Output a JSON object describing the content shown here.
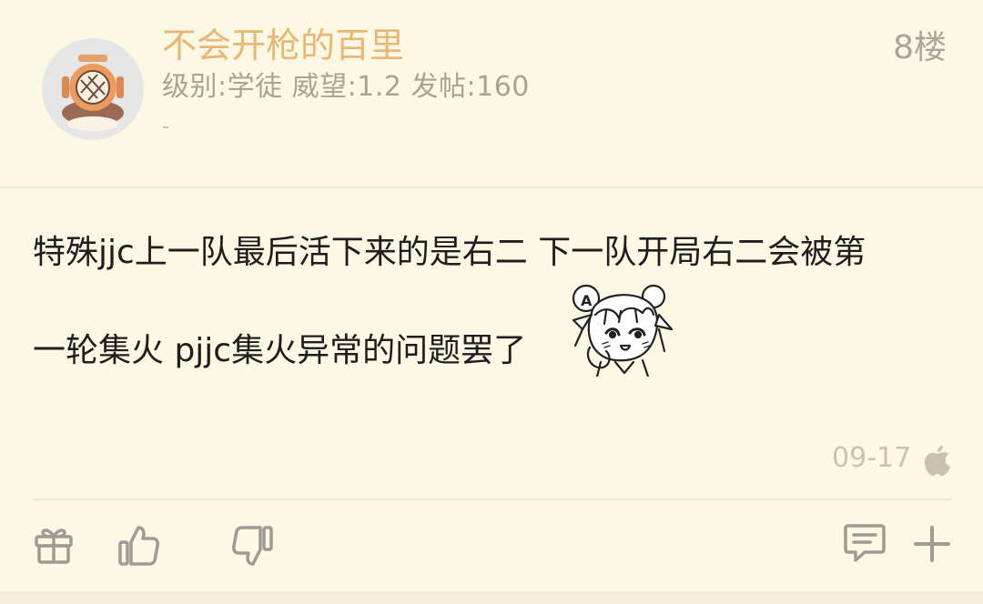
{
  "post": {
    "username": "不会开枪的百里",
    "stats": "级别:学徒 威望:1.2 发帖:160",
    "signature": "-",
    "floor": "8楼",
    "content_line1": "特殊jjc上一队最后活下来的是右二 下一队开局右二会被第",
    "content_line2": "一轮集火 pjjc集火异常的问题罢了",
    "time": "09-17",
    "device_icon": "apple-icon",
    "sticker_icon": "cartoon-girl-sticker"
  },
  "actions": [
    "gift-icon",
    "thumbs-up-icon",
    "thumbs-down-icon",
    "comment-icon",
    "plus-icon"
  ],
  "colors": {
    "background": "#fdf8e4",
    "username": "#e8b773",
    "meta_text": "#a9a392",
    "icon": "#9e9a94"
  }
}
